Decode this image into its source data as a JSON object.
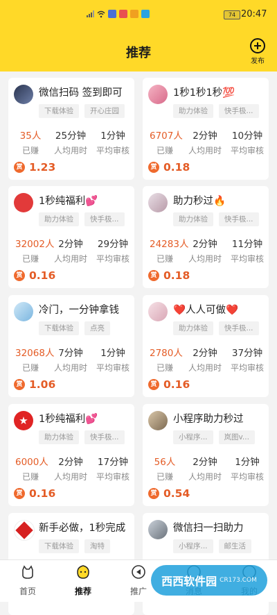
{
  "status": {
    "battery": "74",
    "time": "20:47"
  },
  "header": {
    "title": "推荐",
    "publish_label": "发布"
  },
  "stat_labels": {
    "earned": "已赚",
    "avg_time": "人均用时",
    "avg_review": "平均审核"
  },
  "reward_icon_text": "赏",
  "cards": [
    {
      "title": "微信扫码 签到即可",
      "tags": [
        "下载体验",
        "开心庄园"
      ],
      "earned": "35人",
      "avg_time": "25分钟",
      "avg_review": "1分钟",
      "reward": "1.23",
      "avatar": "photo-avatar"
    },
    {
      "title": "1秒1秒1秒💯",
      "tags": [
        "助力体验",
        "快手极..."
      ],
      "earned": "6707人",
      "avg_time": "2分钟",
      "avg_review": "10分钟",
      "reward": "0.18",
      "avatar": "pink-avatar"
    },
    {
      "title": "1秒纯福利💕",
      "tags": [
        "助力体验",
        "快手极..."
      ],
      "earned": "32002人",
      "avg_time": "2分钟",
      "avg_review": "29分钟",
      "reward": "0.16",
      "avatar": "red-avatar"
    },
    {
      "title": "助力秒过🔥",
      "tags": [
        "助力体验",
        "快手极..."
      ],
      "earned": "24283人",
      "avg_time": "2分钟",
      "avg_review": "11分钟",
      "reward": "0.18",
      "avatar": "girl-avatar"
    },
    {
      "title": "冷门，一分钟拿钱",
      "tags": [
        "下载体验",
        "点亮"
      ],
      "earned": "32068人",
      "avg_time": "7分钟",
      "avg_review": "1分钟",
      "reward": "1.06",
      "avatar": "blue-avatar"
    },
    {
      "title": "❤️人人可做❤️",
      "tags": [
        "助力体验",
        "快手极..."
      ],
      "earned": "2780人",
      "avg_time": "2分钟",
      "avg_review": "37分钟",
      "reward": "0.16",
      "avatar": "cartoon-avatar"
    },
    {
      "title": "1秒纯福利💕",
      "tags": [
        "助力体验",
        "快手极..."
      ],
      "earned": "6000人",
      "avg_time": "2分钟",
      "avg_review": "17分钟",
      "reward": "0.16",
      "avatar": "star-avatar"
    },
    {
      "title": "小程序助力秒过",
      "tags": [
        "小程序...",
        "岚图v..."
      ],
      "earned": "56人",
      "avg_time": "2分钟",
      "avg_review": "1分钟",
      "reward": "0.54",
      "avatar": "man-avatar"
    },
    {
      "title": "新手必做，1秒完成",
      "tags": [
        "下载体验",
        "淘特"
      ],
      "earned": "",
      "avg_time": "",
      "avg_review": "",
      "reward": "",
      "avatar": "fu-avatar"
    },
    {
      "title": "微信扫一扫助力",
      "tags": [
        "小程序...",
        "邮生活"
      ],
      "earned": "",
      "avg_time": "",
      "avg_review": "",
      "reward": "",
      "avatar": "man2-avatar"
    }
  ],
  "tabs": [
    {
      "label": "首页",
      "icon": "home-cat-icon"
    },
    {
      "label": "推荐",
      "icon": "recommend-icon"
    },
    {
      "label": "推广",
      "icon": "promote-icon"
    },
    {
      "label": "消息",
      "icon": "message-icon"
    },
    {
      "label": "我的",
      "icon": "profile-icon"
    }
  ],
  "watermark": {
    "name": "西西软件园",
    "domain": "CR173.COM"
  }
}
